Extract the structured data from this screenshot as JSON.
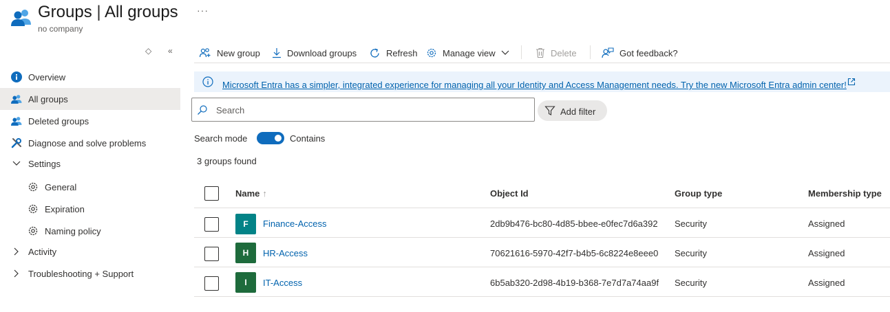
{
  "header": {
    "title": "Groups",
    "separator": "|",
    "page": "All groups",
    "subtitle": "no company",
    "more": "···",
    "icon": "groups-icon"
  },
  "sidebar": {
    "items": [
      {
        "label": "Overview",
        "icon": "info-icon"
      },
      {
        "label": "All groups",
        "icon": "groups-icon",
        "active": true
      },
      {
        "label": "Deleted groups",
        "icon": "groups-icon"
      },
      {
        "label": "Diagnose and solve problems",
        "icon": "wrench-icon"
      },
      {
        "label": "Settings",
        "icon": "chevron-down-icon"
      },
      {
        "label": "General",
        "icon": "gear-icon"
      },
      {
        "label": "Expiration",
        "icon": "gear-icon"
      },
      {
        "label": "Naming policy",
        "icon": "gear-icon"
      },
      {
        "label": "Activity",
        "icon": "chevron-right-icon"
      },
      {
        "label": "Troubleshooting + Support",
        "icon": "chevron-right-icon"
      }
    ]
  },
  "toolbar": {
    "new_group": "New group",
    "download_groups": "Download groups",
    "refresh": "Refresh",
    "manage_view": "Manage view",
    "delete": "Delete",
    "feedback": "Got feedback?"
  },
  "banner": {
    "text": "Microsoft Entra has a simpler, integrated experience for managing all your Identity and Access Management needs. Try the new Microsoft Entra admin center!"
  },
  "search": {
    "placeholder": "Search",
    "add_filter": "Add filter",
    "mode_label": "Search mode",
    "mode_value": "Contains",
    "mode_on": true
  },
  "results": {
    "count_text": "3 groups found"
  },
  "table": {
    "columns": {
      "name": "Name",
      "sort_indicator": "↑",
      "object_id": "Object Id",
      "group_type": "Group type",
      "membership_type": "Membership type"
    },
    "rows": [
      {
        "initial": "F",
        "name": "Finance-Access",
        "object_id": "2db9b476-bc80-4d85-bbee-e0fec7d6a392",
        "group_type": "Security",
        "membership_type": "Assigned",
        "color": "#038387"
      },
      {
        "initial": "H",
        "name": "HR-Access",
        "object_id": "70621616-5970-42f7-b4b5-6c8224e8eee0",
        "group_type": "Security",
        "membership_type": "Assigned",
        "color": "#1e6b3c"
      },
      {
        "initial": "I",
        "name": "IT-Access",
        "object_id": "6b5ab320-2d98-4b19-b368-7e7d7a74aa9f",
        "group_type": "Security",
        "membership_type": "Assigned",
        "color": "#1e6b3c"
      }
    ]
  },
  "colors": {
    "accent": "#0f6cbd",
    "link": "#0062ad",
    "banner_bg": "#ebf3fc",
    "active_nav_bg": "#edebe9"
  }
}
